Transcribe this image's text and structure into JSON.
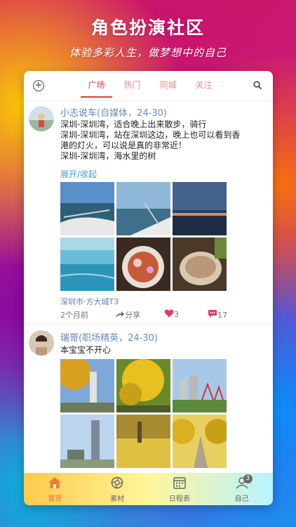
{
  "hero": {
    "title": "角色扮演社区",
    "subtitle": "体验多彩人生，做梦想中的自己"
  },
  "topbar": {
    "tabs": [
      {
        "label": "广场",
        "active": true
      },
      {
        "label": "热门",
        "active": false
      },
      {
        "label": "同城",
        "active": false
      },
      {
        "label": "关注",
        "active": false
      }
    ],
    "icons": [
      "add-circle-icon",
      "search-icon"
    ]
  },
  "posts": [
    {
      "user": "小志说车",
      "meta": "(自媒体，24-30)",
      "lines": [
        "深圳-深圳湾，适合晚上出来散步，骑行",
        "深圳-深圳湾，站在深圳这边，晚上也可以看到香",
        "港的灯火，可以说是真的非常近！",
        "深圳-深圳湾，海水里的树"
      ],
      "expand_label": "展开/收起",
      "location": "深圳市·方大城T3",
      "time": "2个月前",
      "share_label": "分享",
      "likes": "3",
      "comments": "17"
    },
    {
      "user": "瑞哥",
      "meta": "(职场精英，24-30)",
      "text": "本宝宝不开心"
    }
  ],
  "bottomnav": {
    "items": [
      {
        "label": "首页",
        "icon": "home-icon",
        "active": true
      },
      {
        "label": "素材",
        "icon": "aperture-icon",
        "active": false
      },
      {
        "label": "日程表",
        "icon": "calendar-icon",
        "active": false
      },
      {
        "label": "自己",
        "icon": "profile-icon",
        "active": false,
        "badge": "3"
      }
    ]
  },
  "colors": {
    "accent": "#e23b3b",
    "username": "#5b7fb7",
    "link": "#3aa3d8",
    "like": "#e23b6a"
  }
}
